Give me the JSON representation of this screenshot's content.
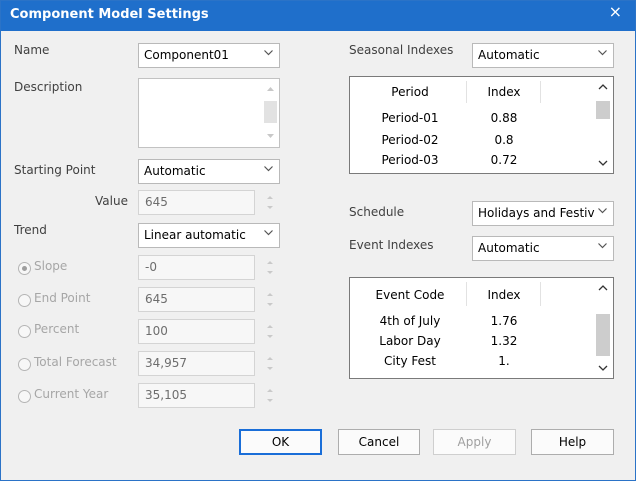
{
  "window": {
    "title": "Component Model Settings",
    "close_glyph": "×"
  },
  "name": {
    "label": "Name",
    "value": "Component01"
  },
  "description": {
    "label": "Description",
    "value": ""
  },
  "starting_point": {
    "label": "Starting Point",
    "value": "Automatic"
  },
  "value_field": {
    "label": "Value",
    "value": "645"
  },
  "trend": {
    "label": "Trend",
    "value": "Linear automatic"
  },
  "trend_options": [
    {
      "label": "Slope",
      "value": "-0",
      "checked": true
    },
    {
      "label": "End Point",
      "value": "645",
      "checked": false
    },
    {
      "label": "Percent",
      "value": "100",
      "checked": false
    },
    {
      "label": "Total Forecast",
      "value": "34,957",
      "checked": false
    },
    {
      "label": "Current Year",
      "value": "35,105",
      "checked": false
    }
  ],
  "seasonal": {
    "label": "Seasonal Indexes",
    "value": "Automatic",
    "columns": [
      "Period",
      "Index"
    ],
    "rows": [
      {
        "period": "Period-01",
        "index": "0.88"
      },
      {
        "period": "Period-02",
        "index": "0.8"
      },
      {
        "period": "Period-03",
        "index": "0.72"
      }
    ]
  },
  "schedule": {
    "label": "Schedule",
    "value": "Holidays and Festiv"
  },
  "events": {
    "label": "Event Indexes",
    "value": "Automatic",
    "columns": [
      "Event Code",
      "Index"
    ],
    "rows": [
      {
        "code": "4th of July",
        "index": "1.76"
      },
      {
        "code": "Labor Day",
        "index": "1.32"
      },
      {
        "code": "City Fest",
        "index": "1."
      }
    ]
  },
  "buttons": {
    "ok": "OK",
    "cancel": "Cancel",
    "apply": "Apply",
    "help": "Help"
  },
  "colors": {
    "titlebar": "#1f6fcb",
    "default_button_border": "#1a6ed8",
    "background": "#f0f0f0"
  }
}
